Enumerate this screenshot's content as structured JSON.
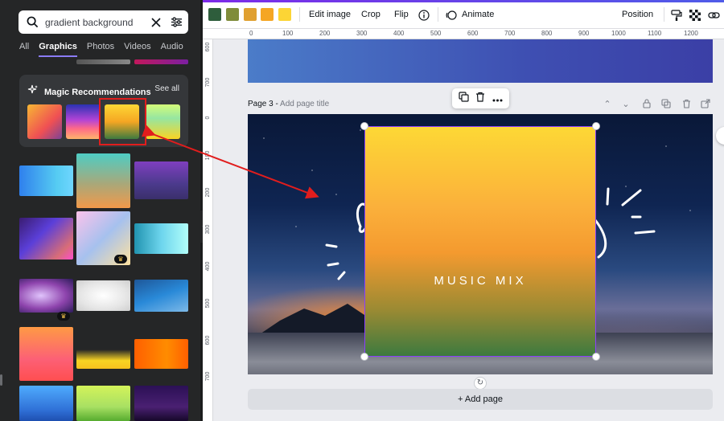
{
  "search": {
    "value": "gradient background"
  },
  "tabs": [
    {
      "label": "All",
      "active": false
    },
    {
      "label": "Graphics",
      "active": true
    },
    {
      "label": "Photos",
      "active": false
    },
    {
      "label": "Videos",
      "active": false
    },
    {
      "label": "Audio",
      "active": false
    }
  ],
  "magic": {
    "title": "Magic Recommendations",
    "see_all": "See all"
  },
  "toolbar": {
    "swatches": [
      "#2e5d3c",
      "#7f8c3a",
      "#e0a030",
      "#f5a623",
      "#fcd535"
    ],
    "edit_image": "Edit image",
    "crop": "Crop",
    "flip": "Flip",
    "animate": "Animate",
    "position": "Position"
  },
  "ruler": {
    "h_labels": [
      "0",
      "100",
      "200",
      "300",
      "400",
      "500",
      "600",
      "700",
      "800",
      "900",
      "1000",
      "1100",
      "1200"
    ],
    "v_labels": [
      "600",
      "700",
      "0",
      "100",
      "200",
      "300",
      "400",
      "500",
      "600",
      "700"
    ]
  },
  "page": {
    "title": "Page 3 - ",
    "title_placeholder": "Add page title"
  },
  "design": {
    "text": "MUSIC MIX"
  },
  "add_page": "+ Add page",
  "crown_badge": "♛"
}
